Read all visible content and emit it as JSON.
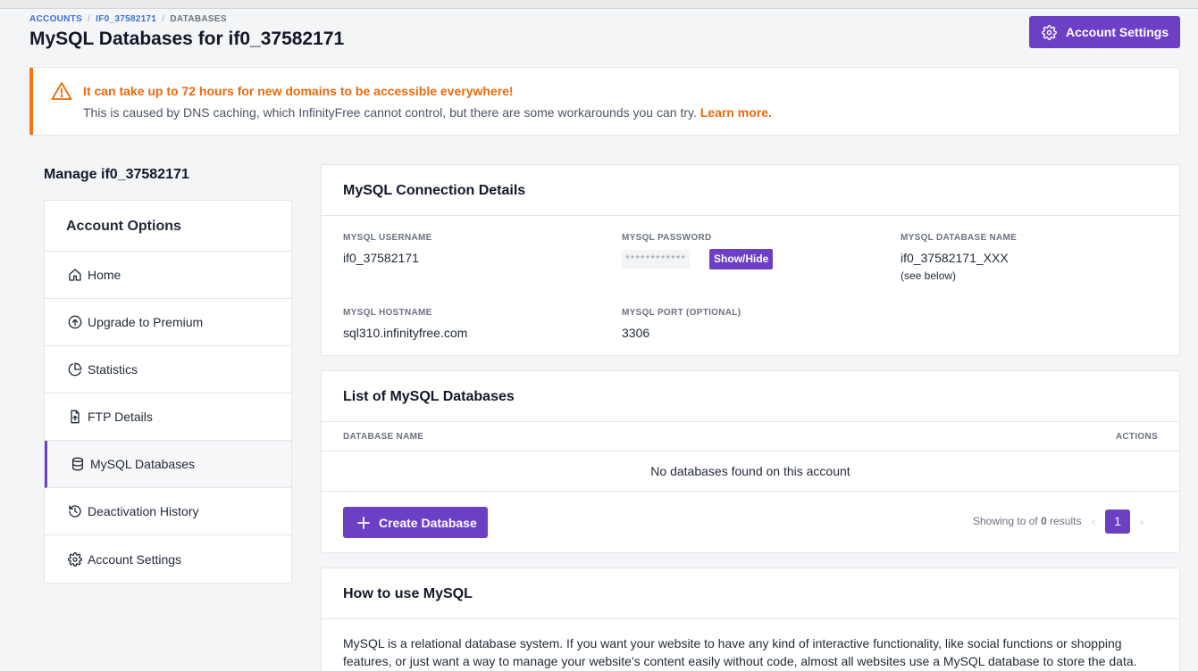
{
  "breadcrumb": {
    "items": [
      "ACCOUNTS",
      "IF0_37582171",
      "DATABASES"
    ],
    "separator": "/"
  },
  "header": {
    "title": "MySQL Databases for if0_37582171",
    "account_settings_label": "Account Settings"
  },
  "alert": {
    "title": "It can take up to 72 hours for new domains to be accessible everywhere!",
    "body": "This is caused by DNS caching, which InfinityFree cannot control, but there are some workarounds you can try.",
    "link": "Learn more."
  },
  "sidebar": {
    "manage_title": "Manage if0_37582171",
    "heading": "Account Options",
    "items": [
      {
        "label": "Home",
        "icon": "home-icon"
      },
      {
        "label": "Upgrade to Premium",
        "icon": "arrow-up-circle-icon"
      },
      {
        "label": "Statistics",
        "icon": "pie-chart-icon"
      },
      {
        "label": "FTP Details",
        "icon": "file-upload-icon"
      },
      {
        "label": "MySQL Databases",
        "icon": "database-icon"
      },
      {
        "label": "Deactivation History",
        "icon": "history-icon"
      },
      {
        "label": "Account Settings",
        "icon": "gear-icon"
      }
    ],
    "active_item": "MySQL Databases"
  },
  "connection": {
    "title": "MySQL Connection Details",
    "username_label": "MYSQL USERNAME",
    "username": "if0_37582171",
    "password_label": "MYSQL PASSWORD",
    "password_mask": "************",
    "show_hide": "Show/Hide",
    "dbname_label": "MYSQL DATABASE NAME",
    "dbname": "if0_37582171_XXX",
    "dbname_note": "(see below)",
    "hostname_label": "MYSQL HOSTNAME",
    "hostname": "sql310.infinityfree.com",
    "port_label": "MYSQL PORT (OPTIONAL)",
    "port": "3306"
  },
  "databases": {
    "title": "List of MySQL Databases",
    "col_name": "DATABASE NAME",
    "col_actions": "ACTIONS",
    "empty_text": "No databases found on this account",
    "create_label": "Create Database",
    "showing_prefix": "Showing to of",
    "showing_count": "0",
    "showing_suffix": "results",
    "prev": "‹",
    "page": "1",
    "next": "›"
  },
  "howto": {
    "title": "How to use MySQL",
    "body": "MySQL is a relational database system. If you want your website to have any kind of interactive functionality, like social functions or shopping features, or just want a way to manage your website's content easily without code, almost all websites use a MySQL database to store the data."
  },
  "colors": {
    "accent": "#6d3fc4",
    "warning": "#ea6a0a",
    "link": "#3b6fd6"
  }
}
